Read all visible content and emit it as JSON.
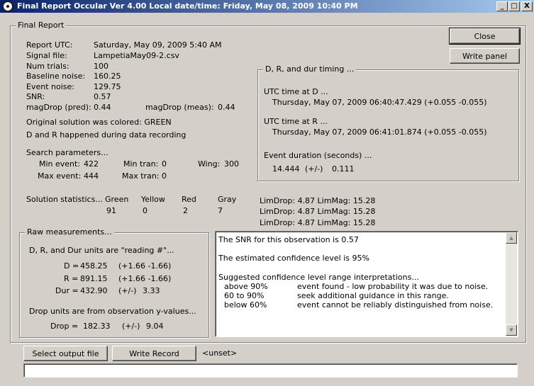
{
  "window": {
    "title": "Final Report Occular Ver 4.00  Local date/time: Friday, May 08, 2009  10:40 PM",
    "minimize_glyph": "_",
    "maximize_glyph": "□",
    "close_glyph": "X"
  },
  "final_report": {
    "legend": "Final Report",
    "report_utc_label": "Report UTC:",
    "report_utc_value": "Saturday, May 09, 2009 5:40 AM",
    "signal_file_label": "Signal file:",
    "signal_file_value": "LampetiaMay09-2.csv",
    "num_trials_label": "Num trials:",
    "num_trials_value": "100",
    "baseline_noise_label": "Baseline noise:",
    "baseline_noise_value": "160.25",
    "event_noise_label": "Event noise:",
    "event_noise_value": "129.75",
    "snr_label": "SNR:",
    "snr_value": "0.57",
    "magdrop_pred_label": "magDrop (pred):",
    "magdrop_pred_value": "0.44",
    "magdrop_meas_label": "magDrop (meas):",
    "magdrop_meas_value": "0.44",
    "original_solution_text": "Original solution was colored:  GREEN",
    "dr_happened_text": "D and R happened during data recording"
  },
  "search_params": {
    "title": "Search parameters...",
    "min_event_label": "Min event:",
    "min_event_value": "422",
    "max_event_label": "Max event:",
    "max_event_value": "444",
    "min_tran_label": "Min tran:",
    "min_tran_value": "0",
    "max_tran_label": "Max tran:",
    "max_tran_value": "0",
    "wing_label": "Wing:",
    "wing_value": "300"
  },
  "solution_stats": {
    "label": "Solution statistics...",
    "columns": [
      {
        "name": "Green",
        "value": "91"
      },
      {
        "name": "Yellow",
        "value": "0"
      },
      {
        "name": "Red",
        "value": "2"
      },
      {
        "name": "Gray",
        "value": "7"
      }
    ]
  },
  "buttons": {
    "close": "Close",
    "write_panel": "Write panel",
    "select_output_file": "Select output file",
    "write_record": "Write Record"
  },
  "timing": {
    "legend": "D, R, and dur timing ...",
    "utc_d_label": "UTC time at D ...",
    "utc_d_value": "Thursday, May 07, 2009 06:40:47.429 (+0.055 -0.055)",
    "utc_r_label": "UTC time at R ...",
    "utc_r_value": "Thursday, May 07, 2009 06:41:01.874 (+0.055 -0.055)",
    "duration_label": "Event duration (seconds) ...",
    "duration_value": "14.444",
    "duration_pm": "(+/-)",
    "duration_err": "0.111"
  },
  "limits": [
    "LimDrop: 4.87  LimMag: 15.28",
    "LimDrop: 4.87  LimMag: 15.28",
    "LimDrop: 4.87  LimMag: 15.28"
  ],
  "raw": {
    "legend": "Raw measurements...",
    "units_text": "D, R, and Dur units are \"reading #\"...",
    "d_label": "D =",
    "d_value": "458.25",
    "d_err": "(+1.66 -1.66)",
    "r_label": "R =",
    "r_value": "891.15",
    "r_err": "(+1.66 -1.66)",
    "dur_label": "Dur =",
    "dur_value": "432.90",
    "dur_pm": "(+/-)",
    "dur_err": "3.33",
    "drop_units_text": "Drop units are from observation y-values...",
    "drop_label": "Drop =",
    "drop_value": "182.33",
    "drop_pm": "(+/-)",
    "drop_err": "9.04"
  },
  "memo": {
    "line1": "The SNR for this observation is 0.57",
    "line2": "The estimated confidence level is 95%",
    "line3": "Suggested confidence level range interpretations...",
    "rows": [
      {
        "range": "above 90%",
        "desc": "event found - low probability it was due to noise."
      },
      {
        "range": "60 to 90%",
        "desc": "seek additional guidance in this range."
      },
      {
        "range": "below 60%",
        "desc": "event cannot be reliably distinguished from noise."
      }
    ]
  },
  "output": {
    "path_label": "<unset>",
    "path_value": ""
  }
}
